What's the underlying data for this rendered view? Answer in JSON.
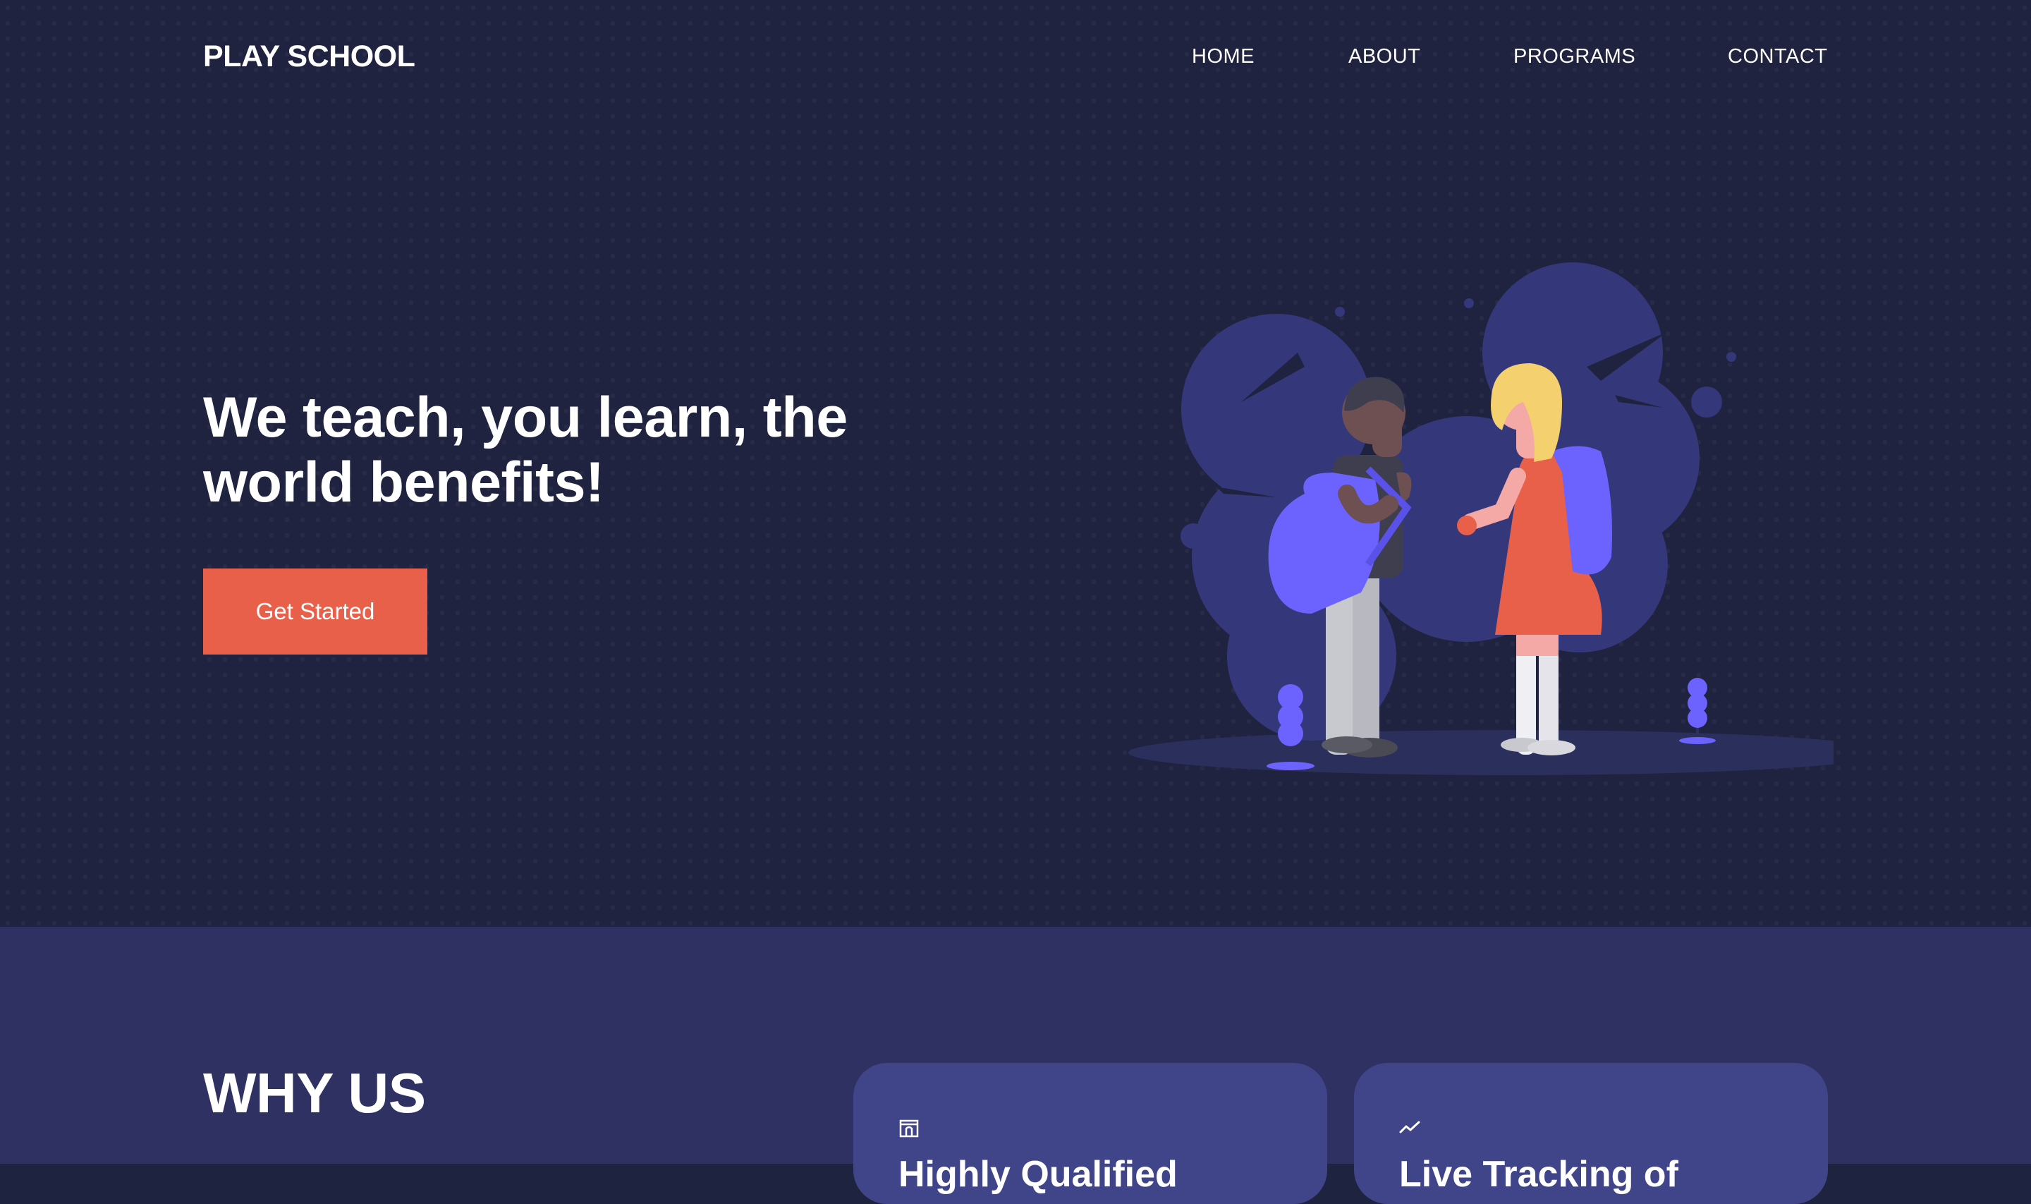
{
  "header": {
    "logo": "PLAY SCHOOL",
    "nav": [
      "HOME",
      "ABOUT",
      "PROGRAMS",
      "CONTACT"
    ]
  },
  "hero": {
    "headline_line1": "We teach, you learn, the",
    "headline_line2": "world benefits!",
    "cta_label": "Get Started"
  },
  "why": {
    "title": "WHY US",
    "cards": [
      {
        "icon": "building-icon",
        "title": "Highly Qualified"
      },
      {
        "icon": "trend-line-icon",
        "title": "Live Tracking of"
      }
    ]
  },
  "colors": {
    "hero_bg": "#1f2340",
    "section_bg": "#2e3162",
    "card_bg": "#404489",
    "accent": "#e8604a",
    "illustration_purple": "#6c63ff"
  }
}
